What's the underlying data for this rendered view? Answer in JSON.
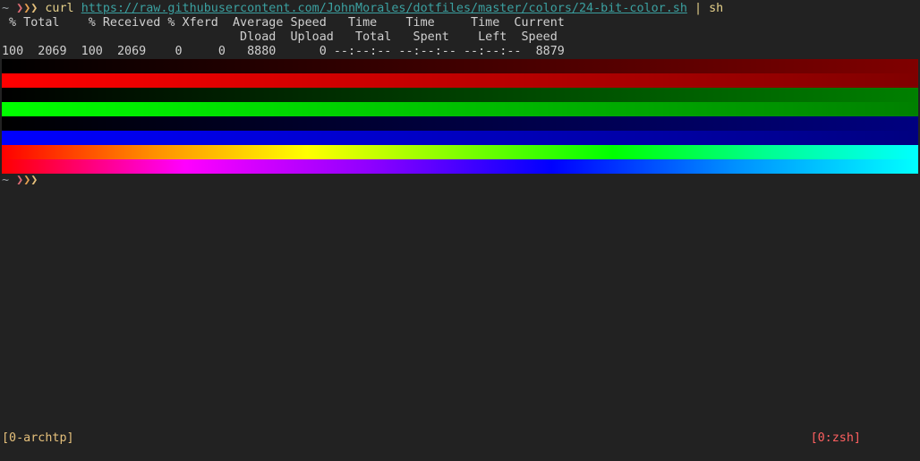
{
  "terminal": {
    "prompt_tilde": "~",
    "prompt_arrows": [
      "❯",
      "❯",
      "❯"
    ],
    "command": "curl",
    "url": "https://raw.githubusercontent.com/JohnMorales/dotfiles/master/colors/24-bit-color.sh",
    "pipe": "| sh",
    "curl_header_1": " % Total    % Received % Xferd  Average Speed   Time    Time     Time  Current",
    "curl_header_2": "                                 Dload  Upload   Total   Spent    Left  Speed",
    "curl_values": "100  2069  100  2069    0     0   8880      0 --:--:-- --:--:-- --:--:--  8879",
    "prompt2_tilde": "~",
    "prompt2_arrows": [
      "❯",
      "❯",
      "❯"
    ]
  },
  "color_bars": [
    {
      "name": "red-dark",
      "from": "#000000",
      "to": "#800000"
    },
    {
      "name": "red",
      "from": "#ff0000",
      "to": "#800000"
    },
    {
      "name": "green-dark",
      "from": "#000000",
      "to": "#008000"
    },
    {
      "name": "green",
      "from": "#00ff00",
      "to": "#008000"
    },
    {
      "name": "blue-dark",
      "from": "#000000",
      "to": "#000080"
    },
    {
      "name": "blue",
      "from": "#0000ff",
      "to": "#000080"
    },
    {
      "name": "rainbow-1",
      "from": "#ff0000",
      "to": "#00ffff"
    },
    {
      "name": "rainbow-2",
      "from": "#ff0000",
      "to": "#00ffff"
    }
  ],
  "statusbar": {
    "session": "[0-archtp]",
    "window": "[0:zsh]"
  },
  "colors": {
    "background": "#222222",
    "text": "#d0d0d0",
    "url": "#3ba0a0",
    "status_left": "#e5c07b",
    "status_right": "#ff6060"
  }
}
